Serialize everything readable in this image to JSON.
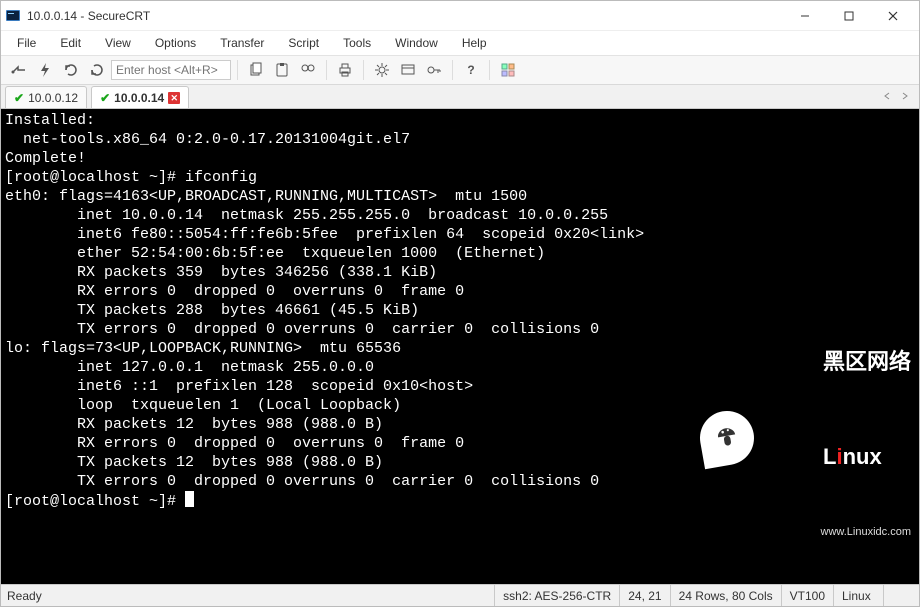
{
  "window": {
    "title": "10.0.0.14 - SecureCRT"
  },
  "menu": {
    "items": [
      "File",
      "Edit",
      "View",
      "Options",
      "Transfer",
      "Script",
      "Tools",
      "Window",
      "Help"
    ]
  },
  "toolbar": {
    "host_placeholder": "Enter host <Alt+R>"
  },
  "tabs": [
    {
      "label": "10.0.0.12",
      "active": false,
      "connected": true
    },
    {
      "label": "10.0.0.14",
      "active": true,
      "connected": true
    }
  ],
  "terminal": {
    "lines": [
      "Installed:",
      "  net-tools.x86_64 0:2.0-0.17.20131004git.el7",
      "",
      "Complete!",
      "[root@localhost ~]# ifconfig",
      "eth0: flags=4163<UP,BROADCAST,RUNNING,MULTICAST>  mtu 1500",
      "        inet 10.0.0.14  netmask 255.255.255.0  broadcast 10.0.0.255",
      "        inet6 fe80::5054:ff:fe6b:5fee  prefixlen 64  scopeid 0x20<link>",
      "        ether 52:54:00:6b:5f:ee  txqueuelen 1000  (Ethernet)",
      "        RX packets 359  bytes 346256 (338.1 KiB)",
      "        RX errors 0  dropped 0  overruns 0  frame 0",
      "        TX packets 288  bytes 46661 (45.5 KiB)",
      "        TX errors 0  dropped 0 overruns 0  carrier 0  collisions 0",
      "",
      "lo: flags=73<UP,LOOPBACK,RUNNING>  mtu 65536",
      "        inet 127.0.0.1  netmask 255.0.0.0",
      "        inet6 ::1  prefixlen 128  scopeid 0x10<host>",
      "        loop  txqueuelen 1  (Local Loopback)",
      "        RX packets 12  bytes 988 (988.0 B)",
      "        RX errors 0  dropped 0  overruns 0  frame 0",
      "        TX packets 12  bytes 988 (988.0 B)",
      "        TX errors 0  dropped 0 overruns 0  carrier 0  collisions 0",
      "",
      "[root@localhost ~]# "
    ]
  },
  "watermark": {
    "brand_cn": "黑区网络",
    "brand_en_prefix": "L",
    "brand_en_mid": "i",
    "brand_en_rest": "nux",
    "url": "www.Linuxidc.com"
  },
  "status": {
    "ready": "Ready",
    "cipher": "ssh2: AES-256-CTR",
    "cursor": "24, 21",
    "dims": "24 Rows, 80 Cols",
    "proto1": "VT100",
    "proto2": "Linux"
  }
}
